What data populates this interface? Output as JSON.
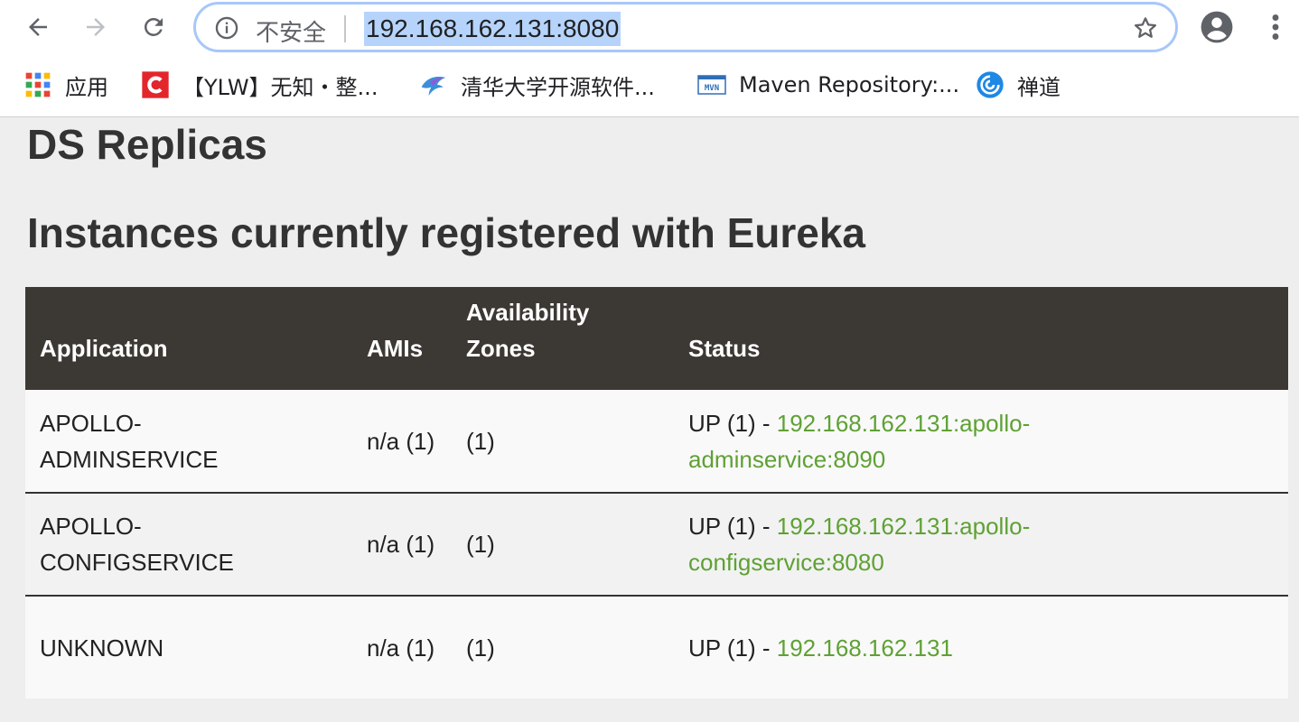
{
  "browser": {
    "omnibox": {
      "security_label": "不安全",
      "url": "192.168.162.131:8080"
    },
    "bookmarks": [
      {
        "label": "应用",
        "icon": "apps-grid-icon"
      },
      {
        "label": "【YLW】无知・整...",
        "icon": "csdn-icon"
      },
      {
        "label": "清华大学开源软件...",
        "icon": "tuna-bird-icon"
      },
      {
        "label": "Maven Repository:...",
        "icon": "mvn-icon"
      },
      {
        "label": "禅道",
        "icon": "zentao-icon"
      }
    ]
  },
  "page": {
    "title": "DS Replicas",
    "instances_heading": "Instances currently registered with Eureka",
    "table": {
      "headers": {
        "application": "Application",
        "amis": "AMIs",
        "zones": "Availability Zones",
        "status": "Status"
      },
      "rows": [
        {
          "application": "APOLLO-ADMINSERVICE",
          "amis": "n/a (1)",
          "zones": "(1)",
          "status_prefix": "UP (1) - ",
          "status_link": "192.168.162.131:apollo-adminservice:8090"
        },
        {
          "application": "APOLLO-CONFIGSERVICE",
          "amis": "n/a (1)",
          "zones": "(1)",
          "status_prefix": "UP (1) - ",
          "status_link": "192.168.162.131:apollo-configservice:8080"
        },
        {
          "application": "UNKNOWN",
          "amis": "n/a (1)",
          "zones": "(1)",
          "status_prefix": "UP (1) - ",
          "status_link": "192.168.162.131"
        }
      ]
    }
  },
  "colors": {
    "table_header_bg": "#3c3834",
    "link": "#5fa134",
    "page_bg": "#eeeeee",
    "url_highlight": "#b6d4fb"
  }
}
